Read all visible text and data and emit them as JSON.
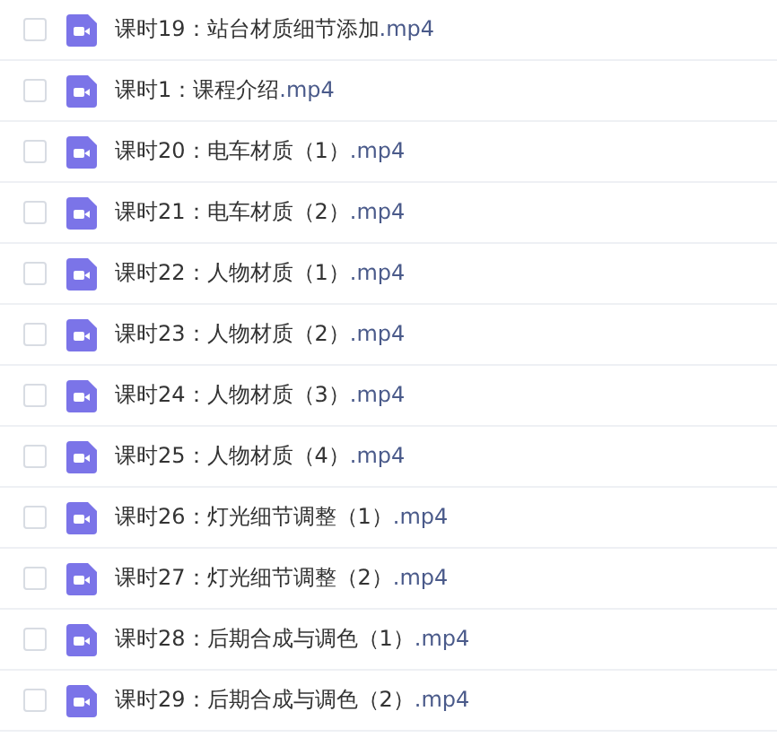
{
  "files": [
    {
      "name": "课时19：站台材质细节添加",
      "ext": ".mp4",
      "checked": false
    },
    {
      "name": "课时1：课程介绍",
      "ext": ".mp4",
      "checked": false
    },
    {
      "name": "课时20：电车材质（1）",
      "ext": ".mp4",
      "checked": false
    },
    {
      "name": "课时21：电车材质（2）",
      "ext": ".mp4",
      "checked": false
    },
    {
      "name": "课时22：人物材质（1）",
      "ext": ".mp4",
      "checked": false
    },
    {
      "name": "课时23：人物材质（2）",
      "ext": ".mp4",
      "checked": false
    },
    {
      "name": "课时24：人物材质（3）",
      "ext": ".mp4",
      "checked": false
    },
    {
      "name": "课时25：人物材质（4）",
      "ext": ".mp4",
      "checked": false
    },
    {
      "name": "课时26：灯光细节调整（1）",
      "ext": ".mp4",
      "checked": false
    },
    {
      "name": "课时27：灯光细节调整（2）",
      "ext": ".mp4",
      "checked": false
    },
    {
      "name": "课时28：后期合成与调色（1）",
      "ext": ".mp4",
      "checked": false
    },
    {
      "name": "课时29：后期合成与调色（2）",
      "ext": ".mp4",
      "checked": false
    }
  ]
}
